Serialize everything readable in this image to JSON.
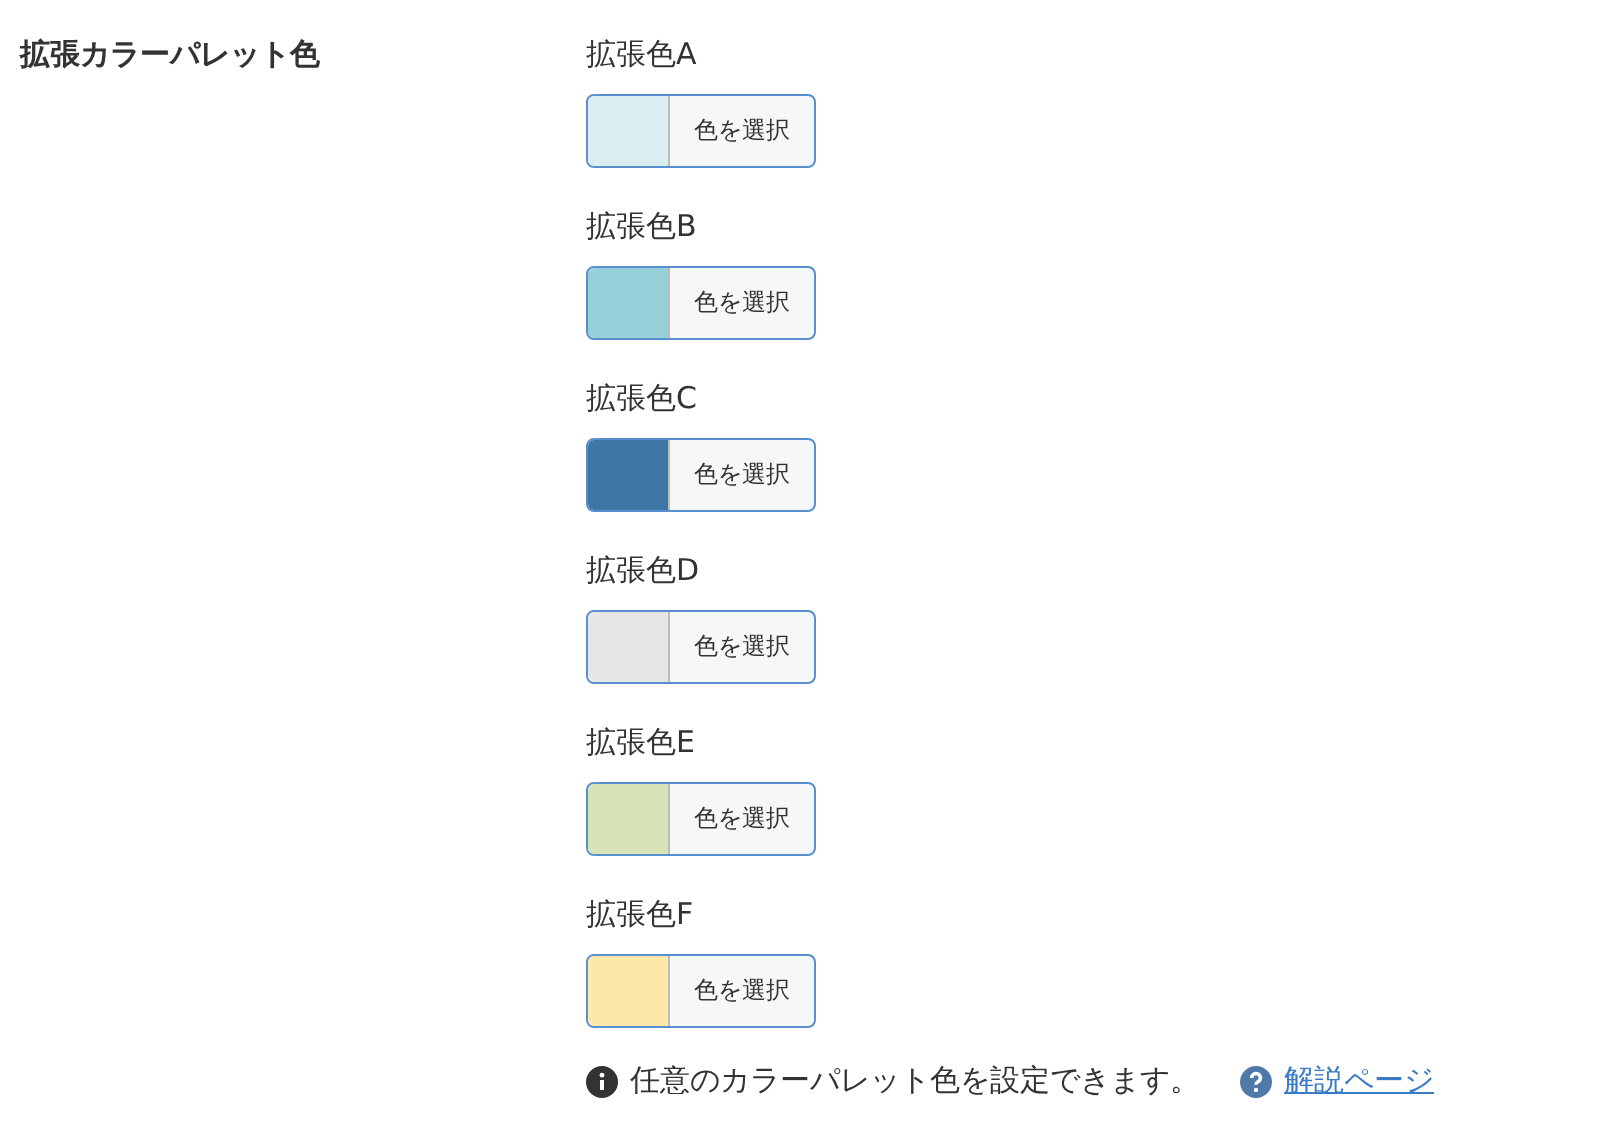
{
  "section_title": "拡張カラーパレット色",
  "colors": [
    {
      "label": "拡張色A",
      "color": "#daeef1",
      "button": "色を選択"
    },
    {
      "label": "拡張色B",
      "color": "#96d0d9",
      "button": "色を選択"
    },
    {
      "label": "拡張色C",
      "color": "#3e77a5",
      "button": "色を選択"
    },
    {
      "label": "拡張色D",
      "color": "#e6e6e6",
      "button": "色を選択"
    },
    {
      "label": "拡張色E",
      "color": "#d8e3b6",
      "button": "色を選択"
    },
    {
      "label": "拡張色F",
      "color": "#fde8aa",
      "button": "色を選択"
    }
  ],
  "description": "任意のカラーパレット色を設定できます。",
  "help_link": "解説ページ"
}
